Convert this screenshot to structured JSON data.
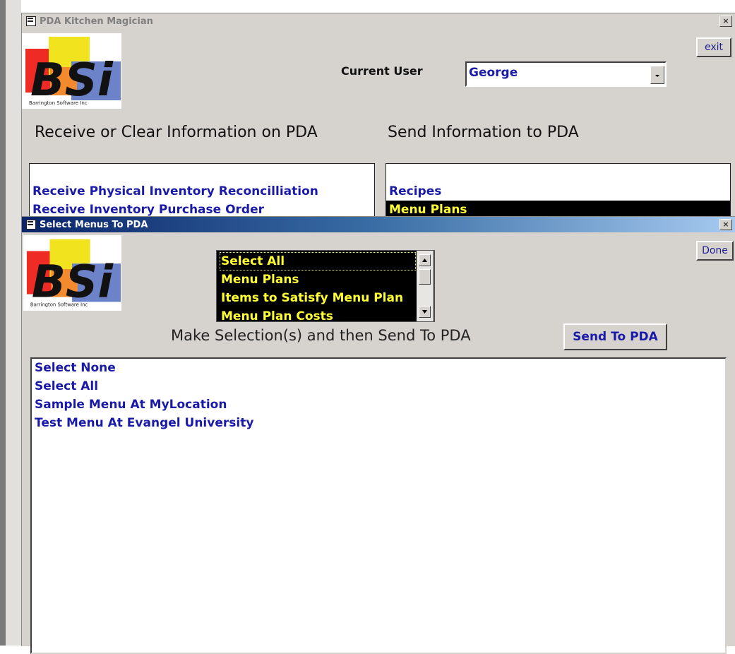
{
  "main_window": {
    "title": "PDA Kitchen Magician",
    "close_glyph": "×",
    "exit_label": "exit",
    "current_user_label": "Current User",
    "current_user_value": "George",
    "receive_heading": "Receive or Clear Information on PDA",
    "send_heading": "Send Information to PDA",
    "receive_items": [
      "Receive Physical Inventory Reconcilliation",
      "Receive Inventory Purchase Order"
    ],
    "send_items": [
      "Recipes",
      "Menu Plans"
    ]
  },
  "dialog": {
    "title": "Select Menus To PDA",
    "close_glyph": "×",
    "done_label": "Done",
    "dropdown_options": [
      "Select All",
      "Menu Plans",
      "Items to Satisfy Menu Plan",
      "Menu Plan Costs"
    ],
    "instruction": "Make Selection(s) and then Send To PDA",
    "send_button_label": "Send To PDA",
    "menu_items": [
      "Select None",
      "Select All",
      "Sample Menu At MyLocation",
      "Test Menu At Evangel University"
    ]
  },
  "logo": {
    "text": "BSi",
    "caption": "Barrington Software Inc"
  },
  "colors": {
    "link_blue": "#1a1aa8",
    "highlight_yellow": "#ffff33",
    "selected_bg": "#000000",
    "title_active": "#0a246a"
  },
  "icons": [
    "form-icon",
    "close-icon",
    "dropdown-arrow-icon",
    "scroll-up-icon",
    "scroll-down-icon"
  ]
}
